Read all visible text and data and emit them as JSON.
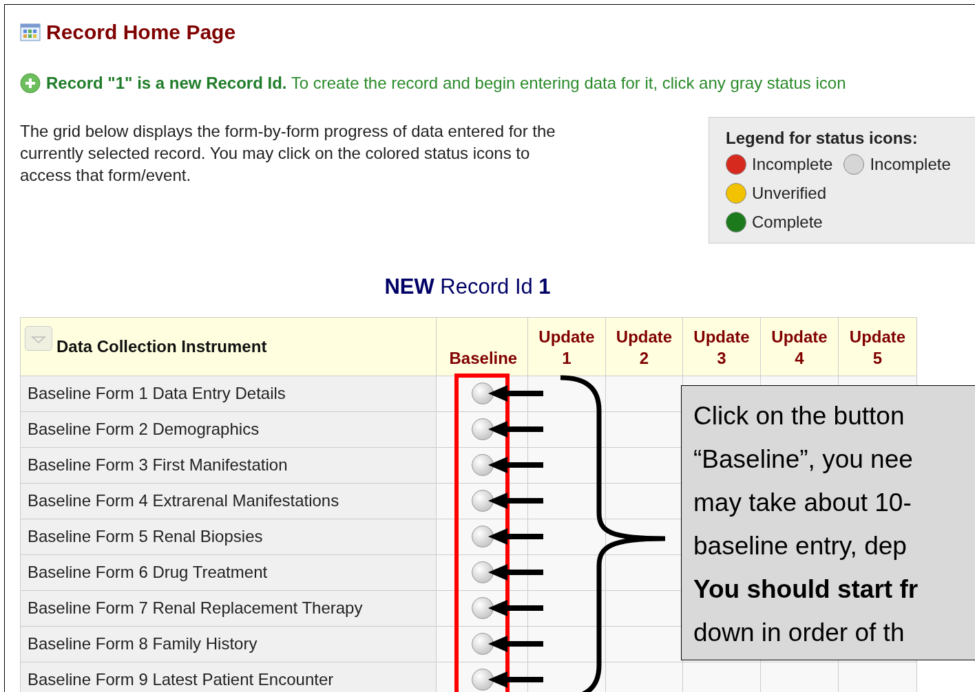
{
  "page": {
    "title": "Record Home Page"
  },
  "message": "**Record \"1\" is a new Record Id.** To create the record and begin entering data for it, click any gray status icon",
  "description": "The grid below displays the form-by-form progress of data entered for the currently selected record. You may click on the colored status icons to access that form/event.",
  "legend": {
    "title": "Legend for status icons:",
    "rows": [
      [
        {
          "label": "Incomplete",
          "color": "#d62a1e"
        },
        {
          "label": "Incomplete",
          "color": "#d6d6d6"
        }
      ],
      [
        {
          "label": "Unverified",
          "color": "#f2c200"
        }
      ],
      [
        {
          "label": "Complete",
          "color": "#1c7a1c"
        }
      ]
    ]
  },
  "record_heading": "**NEW** Record Id **1**",
  "table": {
    "columns": [
      {
        "label": "Data Collection Instrument",
        "kind": "instrument"
      },
      {
        "label": "Baseline",
        "kind": "event"
      },
      {
        "label": "Update 1",
        "kind": "event"
      },
      {
        "label": "Update 2",
        "kind": "event"
      },
      {
        "label": "Update 3",
        "kind": "event"
      },
      {
        "label": "Update 4",
        "kind": "event"
      },
      {
        "label": "Update 5",
        "kind": "event"
      }
    ],
    "rows": [
      {
        "instrument": "Baseline Form 1 Data Entry Details"
      },
      {
        "instrument": "Baseline Form 2 Demographics"
      },
      {
        "instrument": "Baseline Form 3 First Manifestation"
      },
      {
        "instrument": "Baseline Form 4 Extrarenal Manifestations"
      },
      {
        "instrument": "Baseline Form 5 Renal Biopsies"
      },
      {
        "instrument": "Baseline Form 6 Drug Treatment"
      },
      {
        "instrument": "Baseline Form 7 Renal Replacement Therapy"
      },
      {
        "instrument": "Baseline Form 8 Family History"
      },
      {
        "instrument": "Baseline Form 9 Latest Patient Encounter"
      }
    ]
  },
  "callout": {
    "lines": [
      {
        "text": "Click on the button",
        "bold": false
      },
      {
        "text": "“Baseline”, you nee",
        "bold": false
      },
      {
        "text": "may take about 10-",
        "bold": false
      },
      {
        "text": "baseline entry,  dep",
        "bold": false
      },
      {
        "text": "You should start fr",
        "bold": true
      },
      {
        "text": "down in order of th",
        "bold": false
      }
    ]
  }
}
